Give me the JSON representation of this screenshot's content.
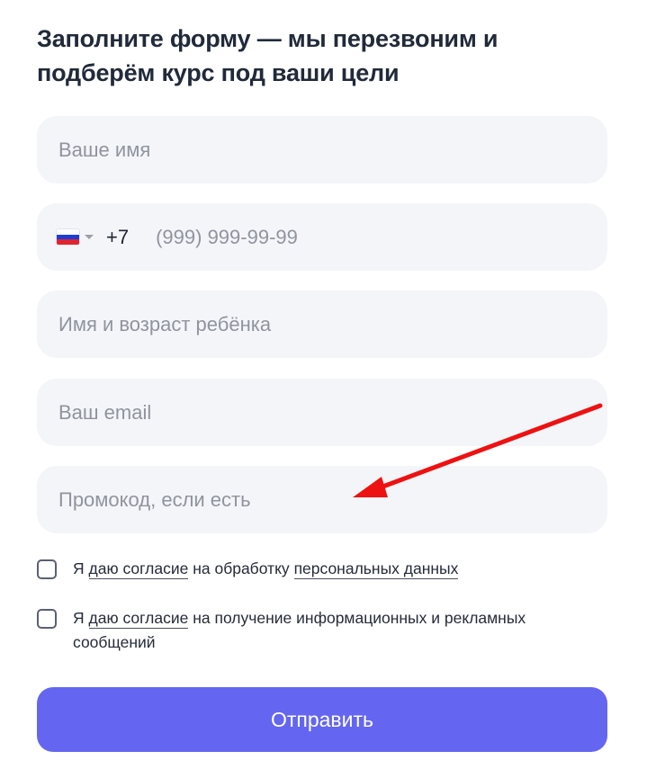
{
  "form": {
    "heading": "Заполните форму — мы перезвоним и подберём курс под ваши цели",
    "name_placeholder": "Ваше имя",
    "phone": {
      "country_flag": "flag-ru-icon",
      "dial_code": "+7",
      "placeholder": "(999) 999-99-99",
      "flag_colors": [
        "#ffffff",
        "#1c3fd4",
        "#e0242f"
      ]
    },
    "child_placeholder": "Имя и возраст ребёнка",
    "email_placeholder": "Ваш email",
    "promo_placeholder": "Промокод, если есть",
    "consent_personal": {
      "prefix": "Я",
      "link1": "даю согласие",
      "middle": "на обработку",
      "link2": "персональных данных"
    },
    "consent_ads": {
      "prefix": "Я",
      "link1": "даю согласие",
      "rest": "на получение информационных и рекламных сообщений"
    },
    "submit_label": "Отправить"
  },
  "colors": {
    "accent": "#6466f1",
    "field_bg": "#f4f5f8",
    "annotation_arrow": "#ee1111"
  }
}
